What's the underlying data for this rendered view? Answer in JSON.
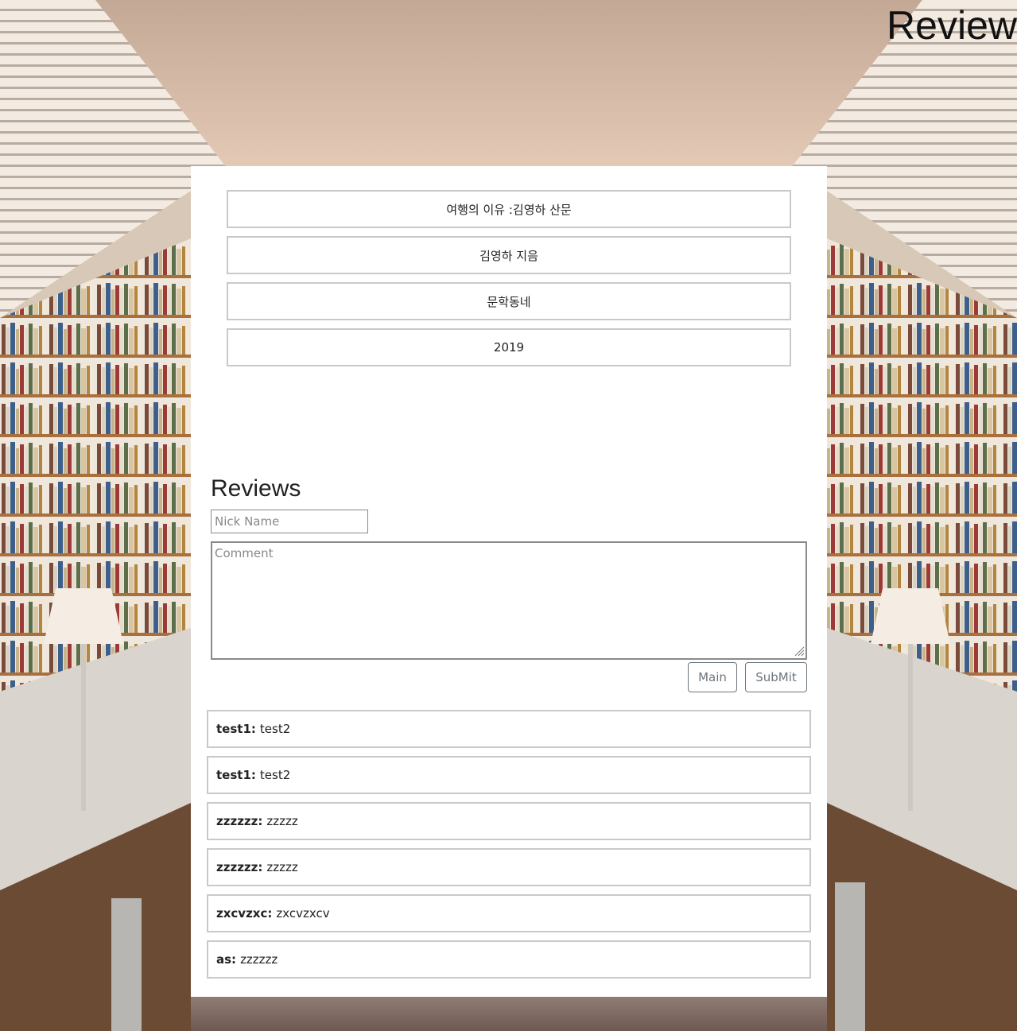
{
  "page": {
    "heading": "Review"
  },
  "book": {
    "title": "여행의 이유 :김영하 산문",
    "author": "김영하 지음",
    "publisher": "문학동네",
    "year": "2019"
  },
  "reviews_section": {
    "title": "Reviews",
    "nickname_placeholder": "Nick Name",
    "comment_placeholder": "Comment",
    "main_button": "Main",
    "submit_button": "SubMit"
  },
  "reviews": [
    {
      "nick": "test1:",
      "comment": "test2"
    },
    {
      "nick": "test1:",
      "comment": "test2"
    },
    {
      "nick": "zzzzzz:",
      "comment": "zzzzz"
    },
    {
      "nick": "zzzzzz:",
      "comment": "zzzzz"
    },
    {
      "nick": "zxcvzxc:",
      "comment": "zxcvzxcv"
    },
    {
      "nick": "as:",
      "comment": "zzzzzz"
    }
  ],
  "colors": {
    "panel_bg": "#ffffff",
    "box_border": "#c9c9c9",
    "button_border": "#6c757d",
    "ceiling": "#c9ad98",
    "shelf_wood": "#a8703f"
  }
}
